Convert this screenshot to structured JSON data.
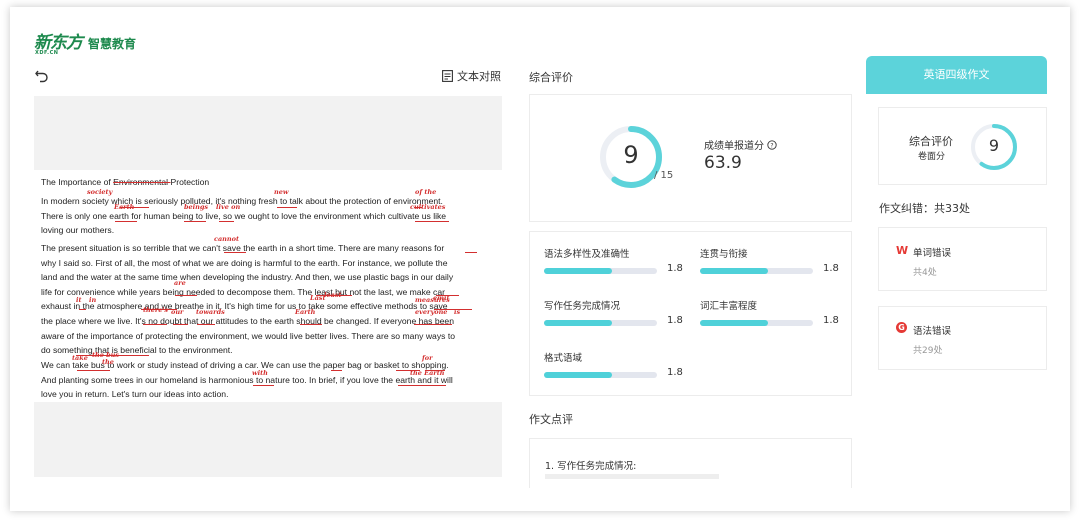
{
  "brand": {
    "logo_main": "新东方",
    "logo_sub": "XDF.CN",
    "name": "智慧教育"
  },
  "toolbar": {
    "compare_label": "文本对照"
  },
  "essay": {
    "title_line": [
      {
        "text": "The Importance of "
      },
      {
        "text": "Environmental ",
        "mark": "strike"
      },
      {
        "text": "Protection"
      }
    ],
    "paragraphs": [
      [
        "In modern society which is seriously polluted, it's nothing fresh to talk about the protection of environment.",
        "There is only one earth for human being to live, so we ought to love the environment which cultivate us like",
        "loving our mothers."
      ],
      [
        "The present situation is so terrible that we can't save the earth in a short time. There are many reasons for",
        "why I said so. First of all, the most of what we are doing is harmful to the earth. For instance, we pollute the",
        "land and the water at the same time when developing the industry. And then, we use plastic bags in our daily",
        "life for convenience while years being needed to decompose them. The least but not the last, we make car",
        "exhaust in the atmosphere and we breathe in it. It's high time for us to take some effective methods to save",
        "the place where we live. It's no doubt that our attitudes to the earth should be changed. If everyone has been",
        "aware of the importance of protecting the environment, we would live better lives. There are so many ways to",
        "do something that is beneficial to the environment."
      ],
      [
        "We can take bus to work or study instead of driving a car. We can use the paper bag or basket to shopping.",
        "And planting some trees in our homeland is harmonious to nature too. In brief, if you love the earth and it will",
        "love you in return. Let's turn our ideas into action."
      ]
    ],
    "annotations": [
      "society",
      "new",
      "of the",
      "Earth",
      "beings",
      "live on",
      "cultivates",
      "cannot",
      "are",
      "Last",
      "least",
      "emit",
      "it",
      "in",
      "measures",
      "there's",
      "our",
      "towards",
      "Earth",
      "everyone",
      "is",
      "take",
      "the bus",
      "the",
      "for",
      "with",
      "the Earth"
    ]
  },
  "overall": {
    "section_title": "综合评价",
    "score": "9",
    "score_total": "/ 15",
    "score_fraction": 0.6,
    "report_label": "成绩单报道分",
    "report_value": "63.9"
  },
  "metrics": [
    {
      "label": "语法多样性及准确性",
      "value": "1.8",
      "fraction": 0.6
    },
    {
      "label": "连贯与衔接",
      "value": "1.8",
      "fraction": 0.6
    },
    {
      "label": "写作任务完成情况",
      "value": "1.8",
      "fraction": 0.6
    },
    {
      "label": "词汇丰富程度",
      "value": "1.8",
      "fraction": 0.6
    },
    {
      "label": "格式语域",
      "value": "1.8",
      "fraction": 0.6
    }
  ],
  "comment": {
    "section_title": "作文点评",
    "first_item": "1. 写作任务完成情况:"
  },
  "side": {
    "tab_label": "英语四级作文",
    "summary_label": "综合评价",
    "summary_sub": "卷面分",
    "summary_score": "9",
    "summary_fraction": 0.6,
    "errors_title": "作文纠错：共33处",
    "errors": [
      {
        "icon": "W",
        "title": "单词错误",
        "count": "共4处"
      },
      {
        "icon": "G",
        "title": "语法错误",
        "count": "共29处"
      }
    ]
  },
  "colors": {
    "accent": "#5cd3da",
    "error": "#d32f2f",
    "brand": "#1e8a4e"
  }
}
